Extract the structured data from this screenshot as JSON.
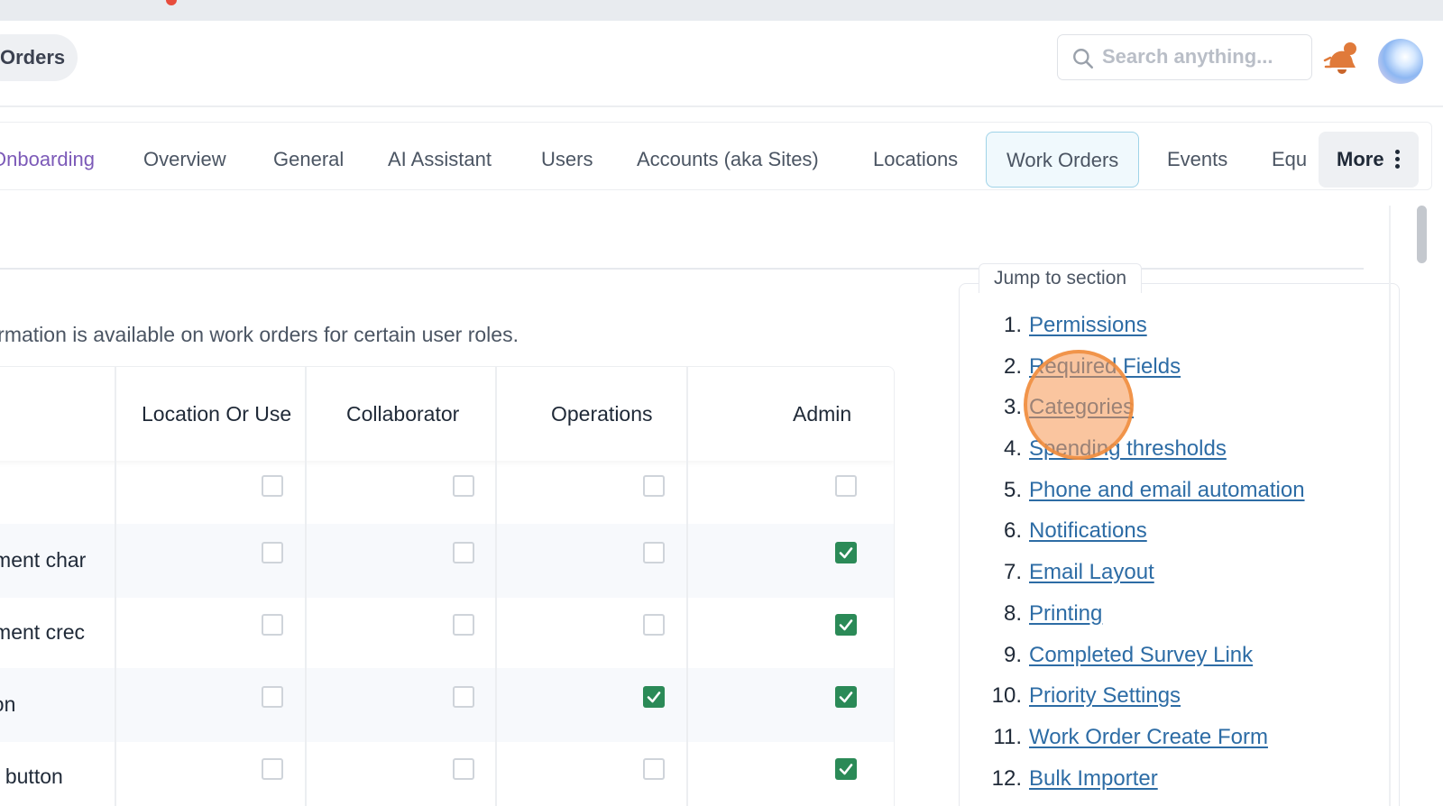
{
  "header": {
    "page_title": "Orders",
    "search_placeholder": "Search anything..."
  },
  "tabs": [
    {
      "label": "Onboarding",
      "state": "partial"
    },
    {
      "label": "Overview"
    },
    {
      "label": "General"
    },
    {
      "label": "AI Assistant"
    },
    {
      "label": "Users"
    },
    {
      "label": "Accounts (aka Sites)"
    },
    {
      "label": "Locations"
    },
    {
      "label": "Work Orders",
      "state": "active"
    },
    {
      "label": "Events"
    },
    {
      "label": "Equ",
      "state": "partial"
    },
    {
      "label": "More"
    }
  ],
  "permissions": {
    "description": "formation is available on work orders for certain user roles.",
    "columns": [
      "Location Or Use",
      "Collaborator",
      "Operations",
      "Admin"
    ],
    "rows": [
      {
        "label": "",
        "checked": [
          false,
          false,
          false,
          false
        ]
      },
      {
        "label": "rtment char",
        "checked": [
          false,
          false,
          false,
          true
        ]
      },
      {
        "label": "rtment crec",
        "checked": [
          false,
          false,
          false,
          true
        ]
      },
      {
        "label": "tton",
        "checked": [
          false,
          false,
          true,
          true
        ]
      },
      {
        "label": "er button",
        "checked": [
          false,
          false,
          false,
          true
        ]
      }
    ],
    "colors": {
      "checked": "#2b8a57",
      "unchecked_border": "#cfd4da"
    }
  },
  "jump_to_section": {
    "title": "Jump to section",
    "items": [
      {
        "num": "1.",
        "label": "Permissions"
      },
      {
        "num": "2.",
        "label": "Required Fields"
      },
      {
        "num": "3.",
        "label": "Categories"
      },
      {
        "num": "4.",
        "label": "Spending thresholds"
      },
      {
        "num": "5.",
        "label": "Phone and email automation"
      },
      {
        "num": "6.",
        "label": "Notifications"
      },
      {
        "num": "7.",
        "label": "Email Layout"
      },
      {
        "num": "8.",
        "label": "Printing"
      },
      {
        "num": "9.",
        "label": "Completed Survey Link"
      },
      {
        "num": "10.",
        "label": "Priority Settings"
      },
      {
        "num": "11.",
        "label": "Work Order Create Form"
      },
      {
        "num": "12.",
        "label": "Bulk Importer"
      }
    ],
    "link_color": "#2d6ca5"
  },
  "icons": {
    "search": "search-icon",
    "notifications": "bell-icon",
    "more": "kebab-icon",
    "checkbox_checked": "checkmark-icon"
  },
  "theme": {
    "active_tab_border": "#9fd3e8",
    "onboarding_tab_color": "#7c5ab8",
    "click_marker": "#f59650"
  }
}
